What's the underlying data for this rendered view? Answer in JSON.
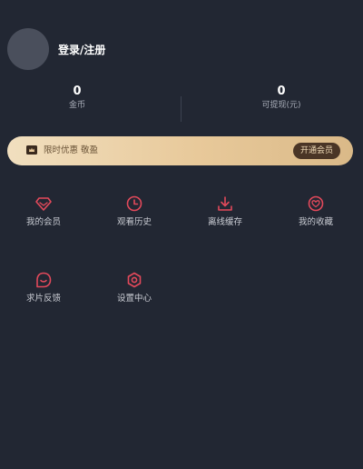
{
  "profile": {
    "login_label": "登录/注册"
  },
  "stats": [
    {
      "value": "0",
      "label": "金币"
    },
    {
      "value": "0",
      "label": "可提现(元)"
    }
  ],
  "vip_banner": {
    "text": "限时优惠 敬盈",
    "button_label": "开通会员"
  },
  "menu": [
    {
      "label": "我的会员",
      "icon": "diamond-icon"
    },
    {
      "label": "观看历史",
      "icon": "clock-icon"
    },
    {
      "label": "离线缓存",
      "icon": "download-icon"
    },
    {
      "label": "我的收藏",
      "icon": "heart-icon"
    },
    {
      "label": "求片反馈",
      "icon": "feedback-icon"
    },
    {
      "label": "设置中心",
      "icon": "settings-icon"
    }
  ],
  "colors": {
    "background": "#222733",
    "accent": "#e3495b",
    "banner_gold": "#e8c99a"
  }
}
